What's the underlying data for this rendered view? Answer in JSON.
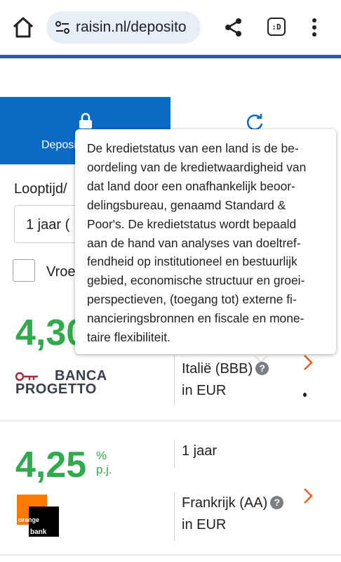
{
  "browser": {
    "url": "raisin.nl/deposito",
    "tabs_count_label": ":D"
  },
  "tabs": {
    "active_label": "Deposito"
  },
  "filters": {
    "term_label": "Looptijd/",
    "term_value": "1 jaar (",
    "checkbox_label": "Vroe"
  },
  "tooltip": {
    "lines": [
      "De kredietstatus van een land is de be-",
      "oordeling van de kredietwaardigheid van",
      "dat land door een onafhankelijk beoor-",
      "delingsbureau, genaamd Standard &",
      "Poor's. De kredietstatus wordt bepaald",
      "aan de hand van analyses van doeltref-",
      "fendheid op institutioneel en bestuurlijk",
      "gebied, economische structuur en groei-",
      "perspectieven, (toegang tot) externe fi-",
      "nancieringsbronnen en fiscale en mone-",
      "taire flexibiliteit."
    ]
  },
  "offers": [
    {
      "rate": "4,30",
      "bank_name_line1": "BANCA",
      "bank_name_line2": "PROGETTO",
      "country": "Italië (BBB)",
      "currency": "in EUR"
    },
    {
      "rate": "4,25",
      "rate_unit": "%",
      "rate_period": "p.j.",
      "term": "1 jaar",
      "bank_logo_line1": "orange",
      "bank_logo_line2": "bank",
      "country": "Frankrijk (AA)",
      "currency": "in EUR"
    }
  ],
  "help_glyph": "?",
  "colors": {
    "brand_blue": "#0b6bc4",
    "rate_green": "#2eab4b",
    "chevron_orange": "#e0611f",
    "orange_brand": "#ff7900"
  }
}
